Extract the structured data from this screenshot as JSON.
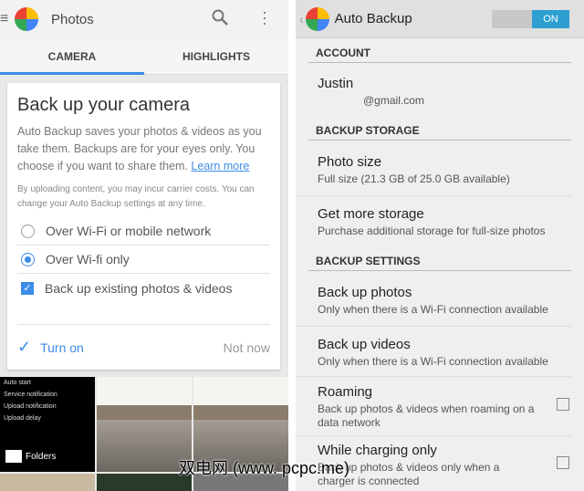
{
  "left": {
    "title": "Photos",
    "tabs": [
      "CAMERA",
      "HIGHLIGHTS"
    ],
    "card": {
      "title": "Back up your camera",
      "body": "Auto Backup saves your photos & videos as you take them. Backups are for your eyes only. You choose if you want to share them.",
      "learn_more": "Learn more",
      "note": "By uploading content, you may incur carrier costs. You can change your Auto Backup settings at any time.",
      "options": [
        "Over Wi-Fi or mobile network",
        "Over Wi-fi only",
        "Back up existing photos & videos"
      ],
      "turn_on": "Turn on",
      "not_now": "Not now"
    },
    "settings_tile": [
      "Auto start",
      "Service notification",
      "Upload notification",
      "Upload delay"
    ],
    "folders": "Folders"
  },
  "right": {
    "title": "Auto Backup",
    "toggle": "ON",
    "sections": {
      "account": "ACCOUNT",
      "storage": "BACKUP STORAGE",
      "settings": "BACKUP SETTINGS"
    },
    "account_name": "Justin",
    "account_email": "@gmail.com",
    "photo_size": {
      "title": "Photo size",
      "sub": "Full size (21.3 GB of 25.0 GB available)"
    },
    "more_storage": {
      "title": "Get more storage",
      "sub": "Purchase additional storage for full-size photos"
    },
    "backup_photos": {
      "title": "Back up photos",
      "sub": "Only when there is a Wi-Fi connection available"
    },
    "backup_videos": {
      "title": "Back up videos",
      "sub": "Only when there is a Wi-Fi connection available"
    },
    "roaming": {
      "title": "Roaming",
      "sub": "Back up photos & videos when roaming on a data network"
    },
    "charging": {
      "title": "While charging only",
      "sub": "Back up photos & videos only when a charger is connected"
    }
  },
  "watermark": "双电网 (www. pcpc.me)"
}
